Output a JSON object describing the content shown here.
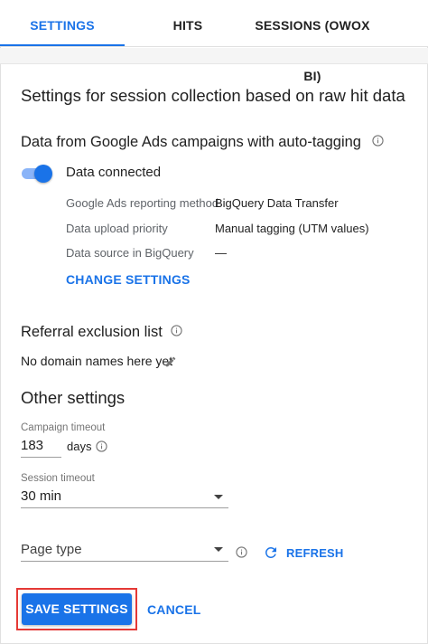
{
  "tabs": [
    {
      "label": "SETTINGS",
      "active": true
    },
    {
      "label": "HITS",
      "active": false
    },
    {
      "label": "SESSIONS (OWOX BI)",
      "active": false
    }
  ],
  "main": {
    "title": "Settings for session collection based on raw hit data",
    "google_ads": {
      "heading": "Data from Google Ads campaigns with auto-tagging",
      "toggle_on": true,
      "toggle_label": "Data connected",
      "rows": [
        {
          "label": "Google Ads reporting method",
          "value": "BigQuery Data Transfer"
        },
        {
          "label": "Data upload priority",
          "value": "Manual tagging (UTM values)"
        },
        {
          "label": "Data source in BigQuery",
          "value": "—"
        }
      ],
      "change_settings_label": "CHANGE SETTINGS"
    },
    "referral": {
      "heading": "Referral exclusion list",
      "empty_text": "No domain names here yet"
    },
    "other": {
      "heading": "Other settings",
      "campaign_timeout": {
        "label": "Campaign timeout",
        "value": "183",
        "unit": "days"
      },
      "session_timeout": {
        "label": "Session timeout",
        "value": "30 min"
      },
      "page_type": {
        "placeholder": "Page type"
      },
      "refresh_label": "REFRESH"
    }
  },
  "footer": {
    "save_label": "SAVE SETTINGS",
    "cancel_label": "CANCEL"
  },
  "colors": {
    "accent": "#1a73e8",
    "highlight_outline": "#e53935"
  },
  "icons": [
    "info-icon",
    "pencil-icon",
    "chevron-down-icon",
    "refresh-icon"
  ]
}
